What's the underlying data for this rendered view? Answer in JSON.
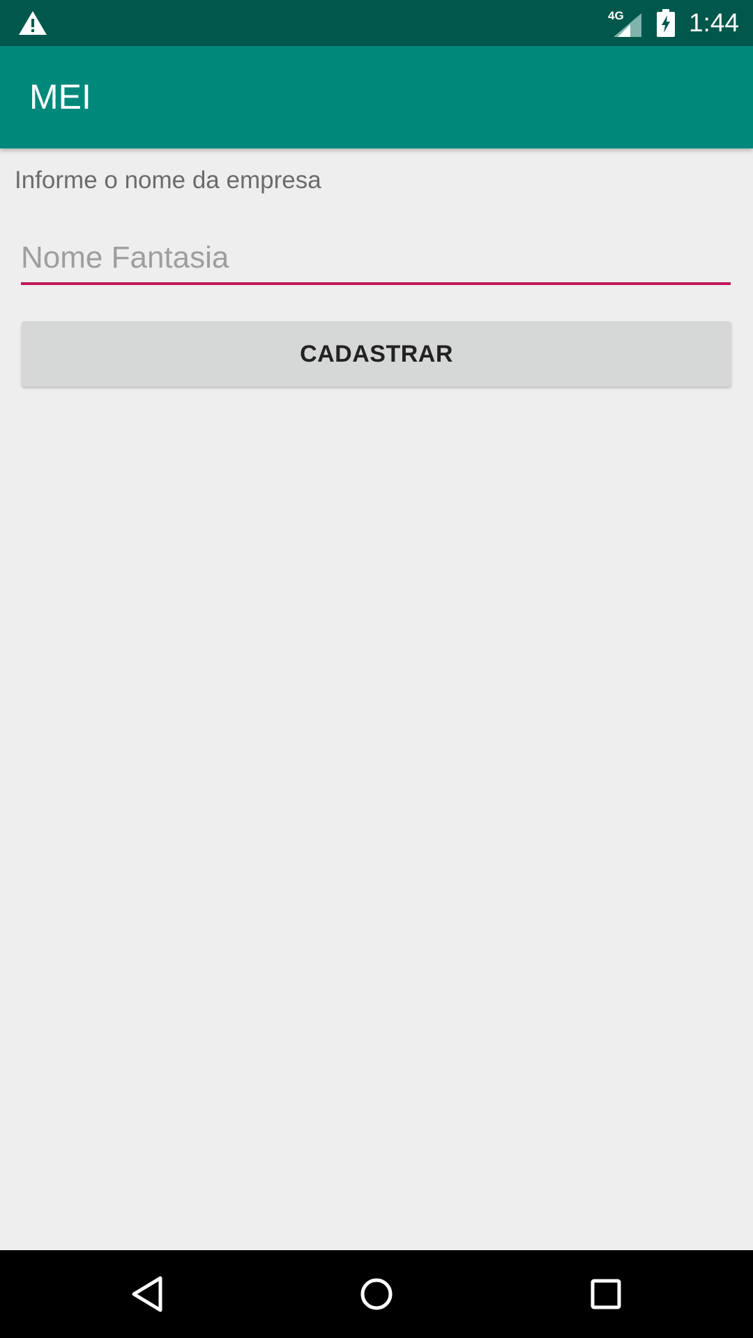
{
  "status_bar": {
    "time": "1:44",
    "network_label": "4G",
    "icons": [
      "warning-icon",
      "signal-icon",
      "battery-charging-icon"
    ]
  },
  "app_bar": {
    "title": "MEI"
  },
  "form": {
    "prompt": "Informe o nome da empresa",
    "name_input": {
      "placeholder": "Nome Fantasia",
      "value": ""
    },
    "register_label": "CADASTRAR"
  },
  "nav_bar": {
    "icons": [
      "back-icon",
      "home-icon",
      "recents-icon"
    ]
  },
  "colors": {
    "status_bar": "#00574b",
    "app_bar": "#00897b",
    "accent": "#c2185b",
    "background": "#eeeeee",
    "button": "#d6d7d7"
  }
}
